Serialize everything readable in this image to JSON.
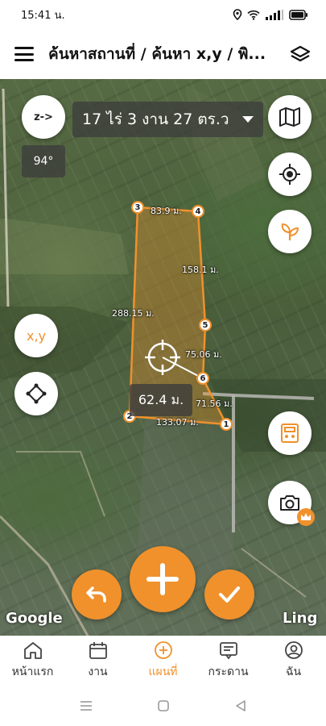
{
  "status_bar": {
    "time": "15:41 น."
  },
  "app_bar": {
    "title": "ค้นหาสถานที่ / ค้นหา x,y / พิ..."
  },
  "map": {
    "area_text": "17 ไร่ 3 งาน 27 ตร.ว",
    "heading": "94°",
    "compass_label": "z->",
    "xy_label": "x,y",
    "center_distance": "62.4 ม.",
    "segments": {
      "s34": "83.9 ม.",
      "s45": "158.1 ม.",
      "s23": "288.15 ม.",
      "s56": "75.06 ม.",
      "s61": "71.56 ม.",
      "s12": "133.07 ม."
    },
    "markers": [
      "1",
      "2",
      "3",
      "4",
      "5",
      "6"
    ],
    "google_text": "Google",
    "ling_text": "Ling"
  },
  "nav": {
    "items": [
      {
        "label": "หน้าแรก",
        "icon": "home-icon"
      },
      {
        "label": "งาน",
        "icon": "calendar-icon"
      },
      {
        "label": "แผนที่",
        "icon": "plus-circle-icon"
      },
      {
        "label": "กระดาน",
        "icon": "board-icon"
      },
      {
        "label": "ฉัน",
        "icon": "user-icon"
      }
    ],
    "active_index": 2
  },
  "colors": {
    "accent": "#f0912c",
    "polygon_fill": "rgba(240,145,44,0.35)"
  }
}
